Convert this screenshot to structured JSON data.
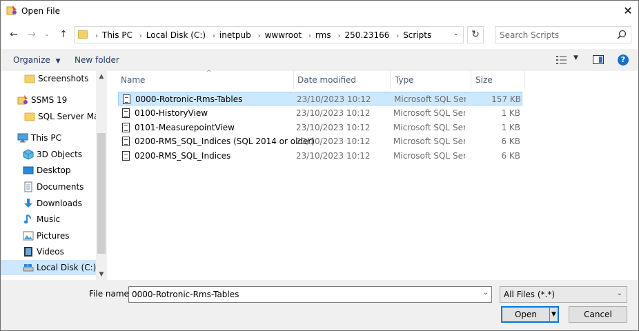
{
  "window": {
    "title": "Open File"
  },
  "address_bar": {
    "crumbs": [
      "This PC",
      "Local Disk (C:)",
      "inetpub",
      "wwwroot",
      "rms",
      "250.23166",
      "Scripts"
    ]
  },
  "search": {
    "placeholder": "Search Scripts"
  },
  "toolbar": {
    "organize_label": "Organize",
    "new_folder_label": "New folder"
  },
  "nav_pane": {
    "items": [
      {
        "label": "Screenshots",
        "icon": "folder-icon"
      },
      {
        "label": "SSMS 19",
        "icon": "ssms-icon"
      },
      {
        "label": "SQL Server Mana",
        "icon": "folder-icon"
      },
      {
        "label": "This PC",
        "icon": "computer-icon"
      },
      {
        "label": "3D Objects",
        "icon": "cube-icon"
      },
      {
        "label": "Desktop",
        "icon": "desktop-icon"
      },
      {
        "label": "Documents",
        "icon": "documents-icon"
      },
      {
        "label": "Downloads",
        "icon": "download-icon"
      },
      {
        "label": "Music",
        "icon": "music-icon"
      },
      {
        "label": "Pictures",
        "icon": "pictures-icon"
      },
      {
        "label": "Videos",
        "icon": "videos-icon"
      },
      {
        "label": "Local Disk (C:)",
        "icon": "drive-icon"
      }
    ],
    "selected": "Local Disk (C:)"
  },
  "file_list": {
    "columns": [
      "Name",
      "Date modified",
      "Type",
      "Size"
    ],
    "rows": [
      {
        "name": "0000-Rotronic-Rms-Tables",
        "date": "23/10/2023 10:12",
        "type": "Microsoft SQL Ser...",
        "size": "157 KB"
      },
      {
        "name": "0100-HistoryView",
        "date": "23/10/2023 10:12",
        "type": "Microsoft SQL Ser...",
        "size": "1 KB"
      },
      {
        "name": "0101-MeasurepointView",
        "date": "23/10/2023 10:12",
        "type": "Microsoft SQL Ser...",
        "size": "1 KB"
      },
      {
        "name": "0200-RMS_SQL_Indices (SQL 2014 or older)",
        "date": "23/10/2023 10:12",
        "type": "Microsoft SQL Ser...",
        "size": "6 KB"
      },
      {
        "name": "0200-RMS_SQL_Indices",
        "date": "23/10/2023 10:12",
        "type": "Microsoft SQL Ser...",
        "size": "6 KB"
      }
    ],
    "selected": "0000-Rotronic-Rms-Tables"
  },
  "footer": {
    "file_name_label": "File name:",
    "file_name_value": "0000-Rotronic-Rms-Tables",
    "filter_value": "All Files (*.*)",
    "open_label": "Open",
    "cancel_label": "Cancel"
  },
  "colors": {
    "selection": "#cce8ff",
    "selection_border": "#99d1ff",
    "accent": "#0078d7",
    "folder": "#f3d16a"
  }
}
